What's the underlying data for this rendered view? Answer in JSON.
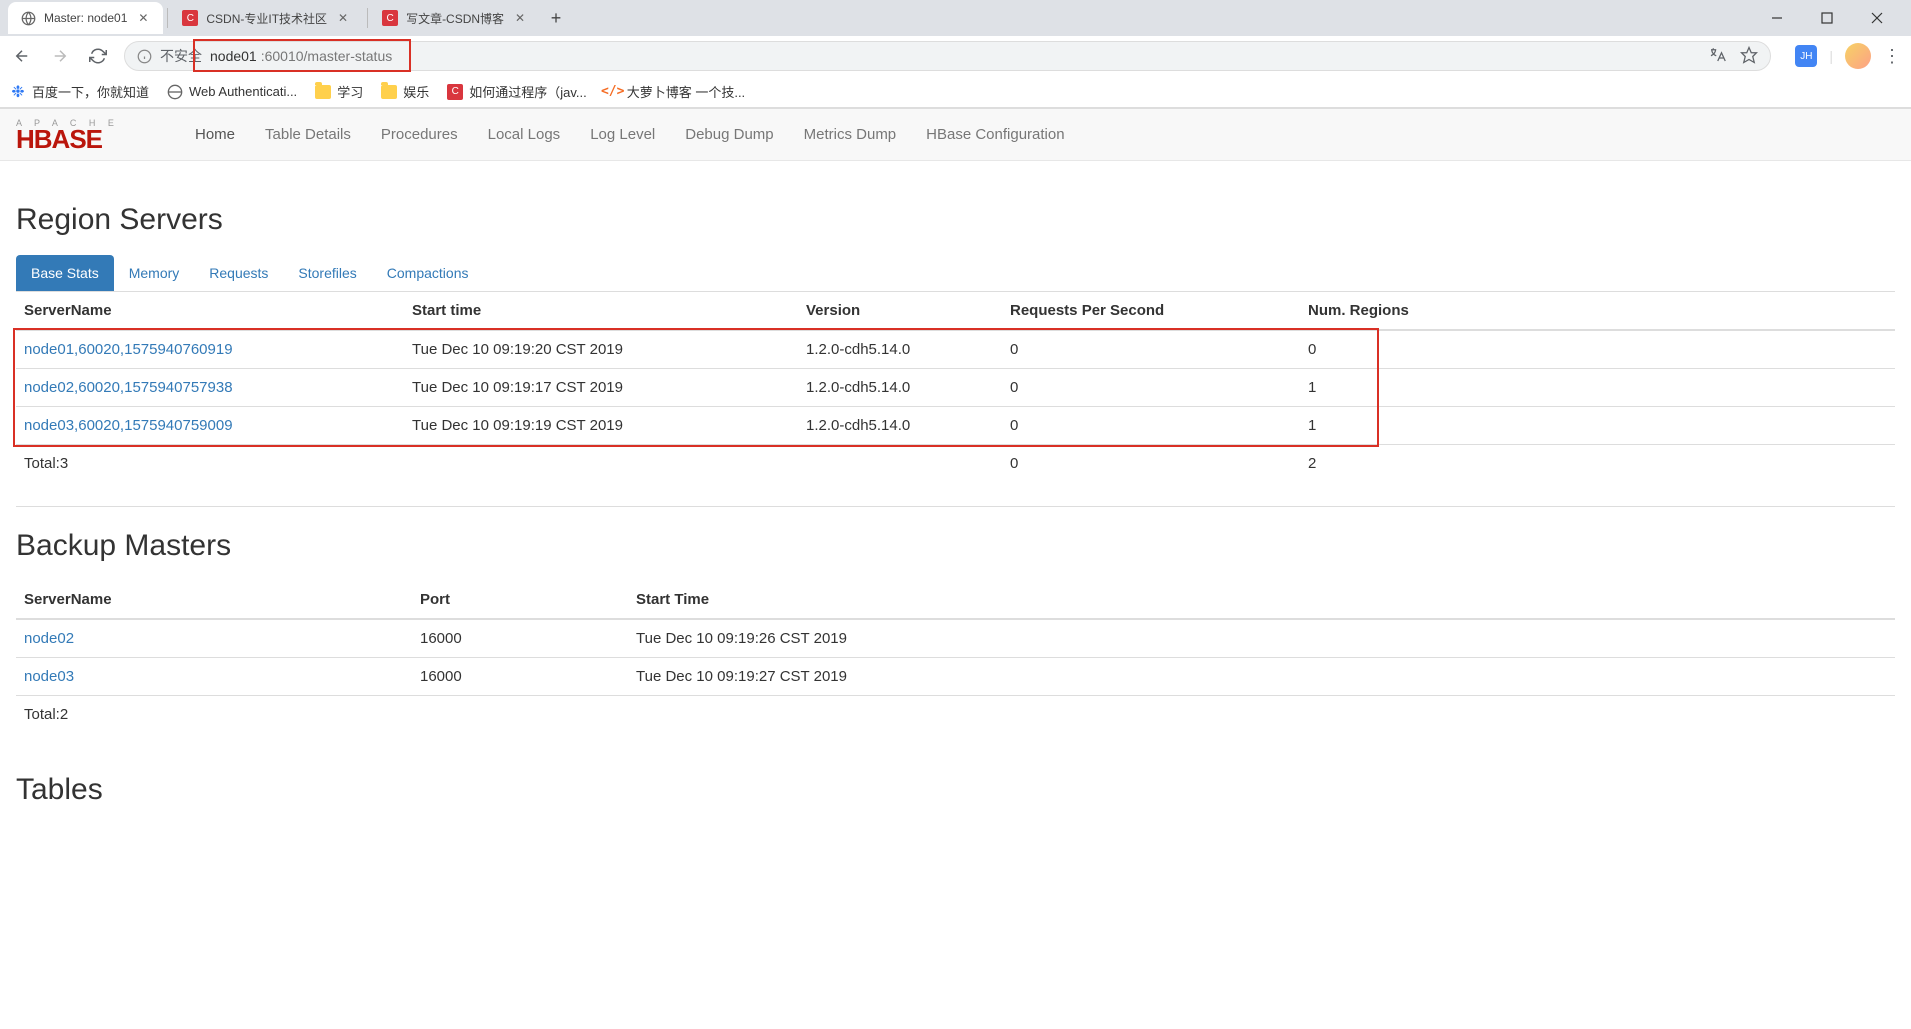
{
  "browser": {
    "tabs": [
      {
        "title": "Master: node01",
        "active": true,
        "icon": "globe"
      },
      {
        "title": "CSDN-专业IT技术社区",
        "active": false,
        "icon": "csdn"
      },
      {
        "title": "写文章-CSDN博客",
        "active": false,
        "icon": "csdn"
      }
    ],
    "address": {
      "prefix": "不安全",
      "host": "node01",
      "port_path": ":60010/master-status"
    },
    "bookmarks": [
      {
        "label": "百度一下，你就知道",
        "icon": "baidu"
      },
      {
        "label": "Web Authenticati...",
        "icon": "mobile"
      },
      {
        "label": "学习",
        "icon": "folder"
      },
      {
        "label": "娱乐",
        "icon": "folder"
      },
      {
        "label": "如何通过程序（jav...",
        "icon": "csdn"
      },
      {
        "label": "大萝卜博客 一个技...",
        "icon": "brackets"
      }
    ],
    "avatar_text": "JH"
  },
  "hbase_nav": {
    "logo_top": "A P A C H E",
    "items": [
      "Home",
      "Table Details",
      "Procedures",
      "Local Logs",
      "Log Level",
      "Debug Dump",
      "Metrics Dump",
      "HBase Configuration"
    ]
  },
  "region_servers": {
    "heading": "Region Servers",
    "tabs": [
      "Base Stats",
      "Memory",
      "Requests",
      "Storefiles",
      "Compactions"
    ],
    "headers": [
      "ServerName",
      "Start time",
      "Version",
      "Requests Per Second",
      "Num. Regions"
    ],
    "rows": [
      {
        "server": "node01,60020,1575940760919",
        "start": "Tue Dec 10 09:19:20 CST 2019",
        "version": "1.2.0-cdh5.14.0",
        "rps": "0",
        "regions": "0"
      },
      {
        "server": "node02,60020,1575940757938",
        "start": "Tue Dec 10 09:19:17 CST 2019",
        "version": "1.2.0-cdh5.14.0",
        "rps": "0",
        "regions": "1"
      },
      {
        "server": "node03,60020,1575940759009",
        "start": "Tue Dec 10 09:19:19 CST 2019",
        "version": "1.2.0-cdh5.14.0",
        "rps": "0",
        "regions": "1"
      }
    ],
    "total": {
      "label": "Total:3",
      "rps": "0",
      "regions": "2"
    }
  },
  "backup_masters": {
    "heading": "Backup Masters",
    "headers": [
      "ServerName",
      "Port",
      "Start Time"
    ],
    "rows": [
      {
        "server": "node02",
        "port": "16000",
        "start": "Tue Dec 10 09:19:26 CST 2019"
      },
      {
        "server": "node03",
        "port": "16000",
        "start": "Tue Dec 10 09:19:27 CST 2019"
      }
    ],
    "total": "Total:2"
  },
  "tables": {
    "heading": "Tables"
  }
}
